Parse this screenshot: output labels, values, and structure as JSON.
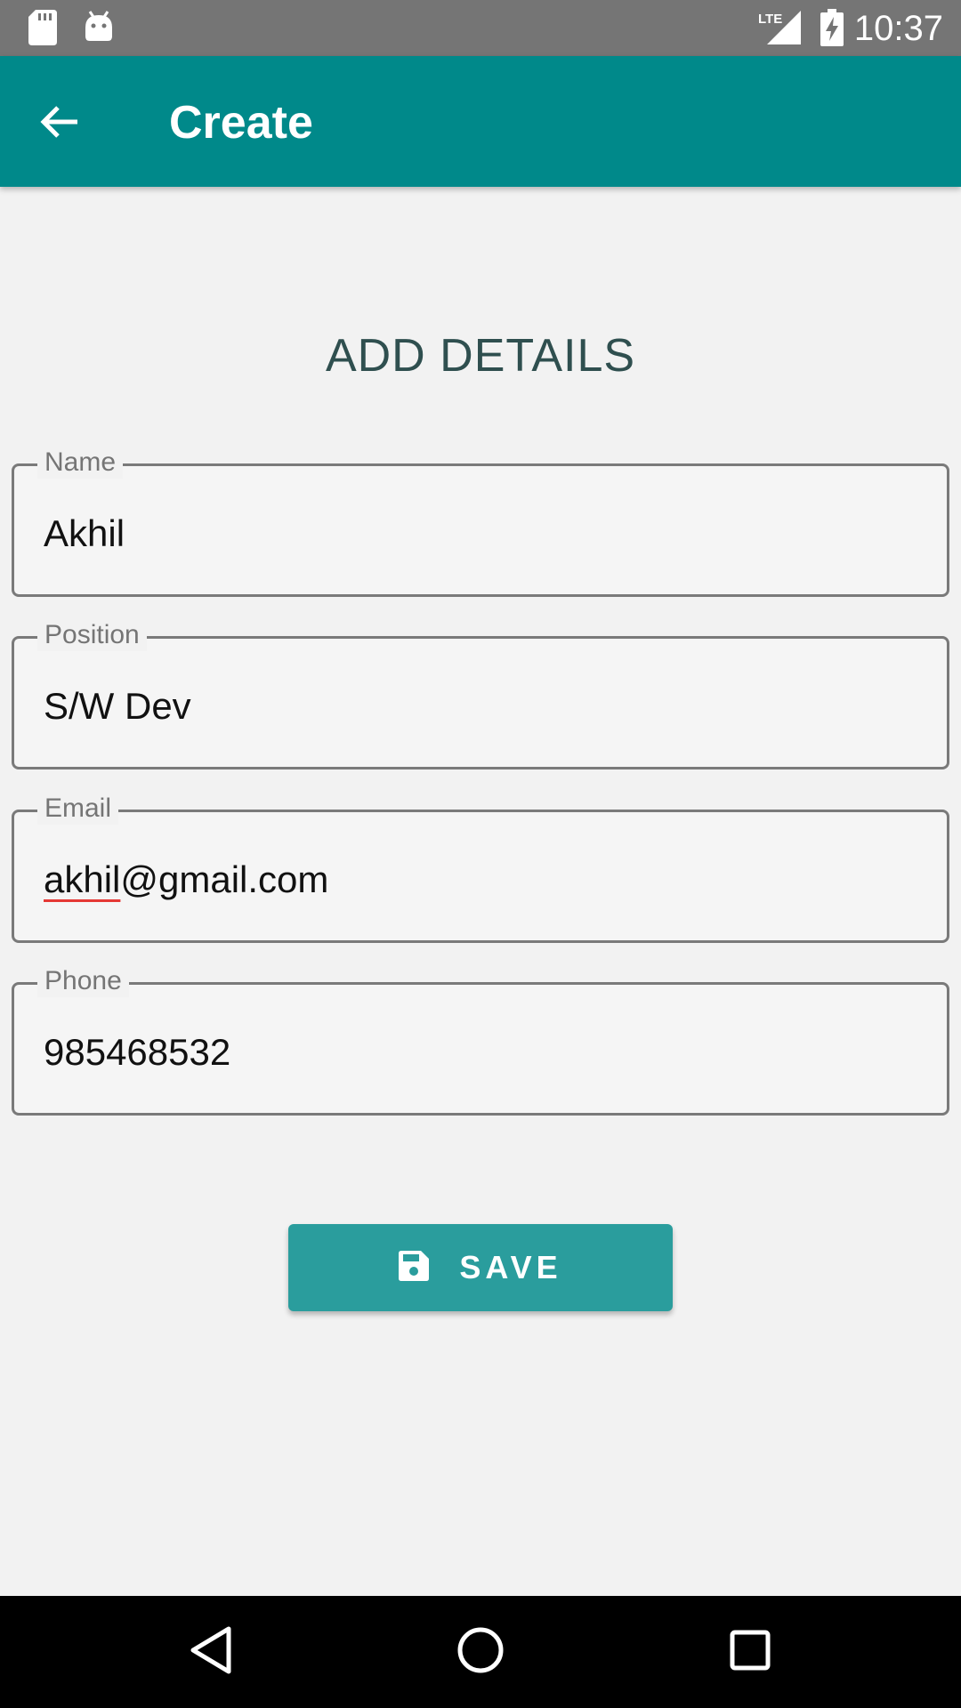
{
  "status_bar": {
    "time": "10:37",
    "network_label": "LTE",
    "icons": [
      "sd-card-icon",
      "android-icon",
      "lte-signal-icon",
      "battery-charging-icon"
    ]
  },
  "app_bar": {
    "title": "Create",
    "back_icon": "arrow-back-icon",
    "color": "#00898a"
  },
  "form": {
    "heading": "ADD DETAILS",
    "fields": [
      {
        "label": "Name",
        "value": "Akhil"
      },
      {
        "label": "Position",
        "value": "S/W Dev"
      },
      {
        "label": "Email",
        "value_misspelled": "akhil",
        "value_rest": "@gmail.com"
      },
      {
        "label": "Phone",
        "value": "985468532"
      }
    ],
    "save_button": {
      "label": "SAVE",
      "icon": "save-icon",
      "color": "#2a9d9d"
    }
  },
  "nav_bar": {
    "icons": [
      "nav-back-icon",
      "nav-home-icon",
      "nav-recents-icon"
    ]
  }
}
